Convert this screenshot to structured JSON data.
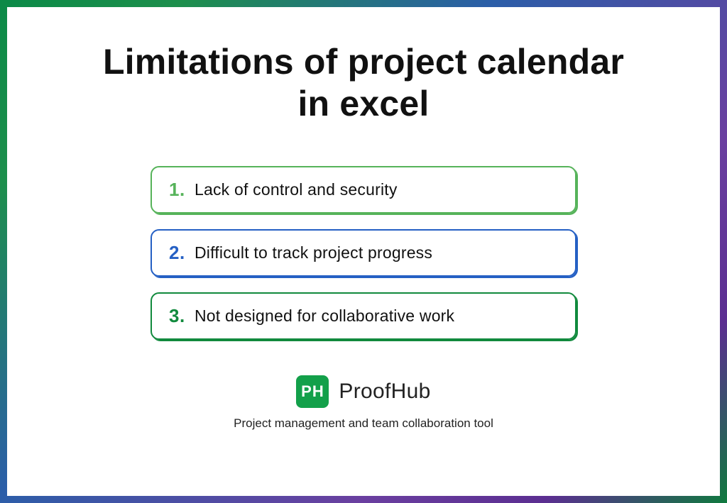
{
  "title": "Limitations of project calendar in excel",
  "items": [
    {
      "num": "1.",
      "text": "Lack of control and security"
    },
    {
      "num": "2.",
      "text": "Difficult to track project progress"
    },
    {
      "num": "3.",
      "text": "Not designed for collaborative work"
    }
  ],
  "brand": {
    "badge": "PH",
    "name": "ProofHub",
    "tagline": "Project management and team collaboration tool"
  }
}
